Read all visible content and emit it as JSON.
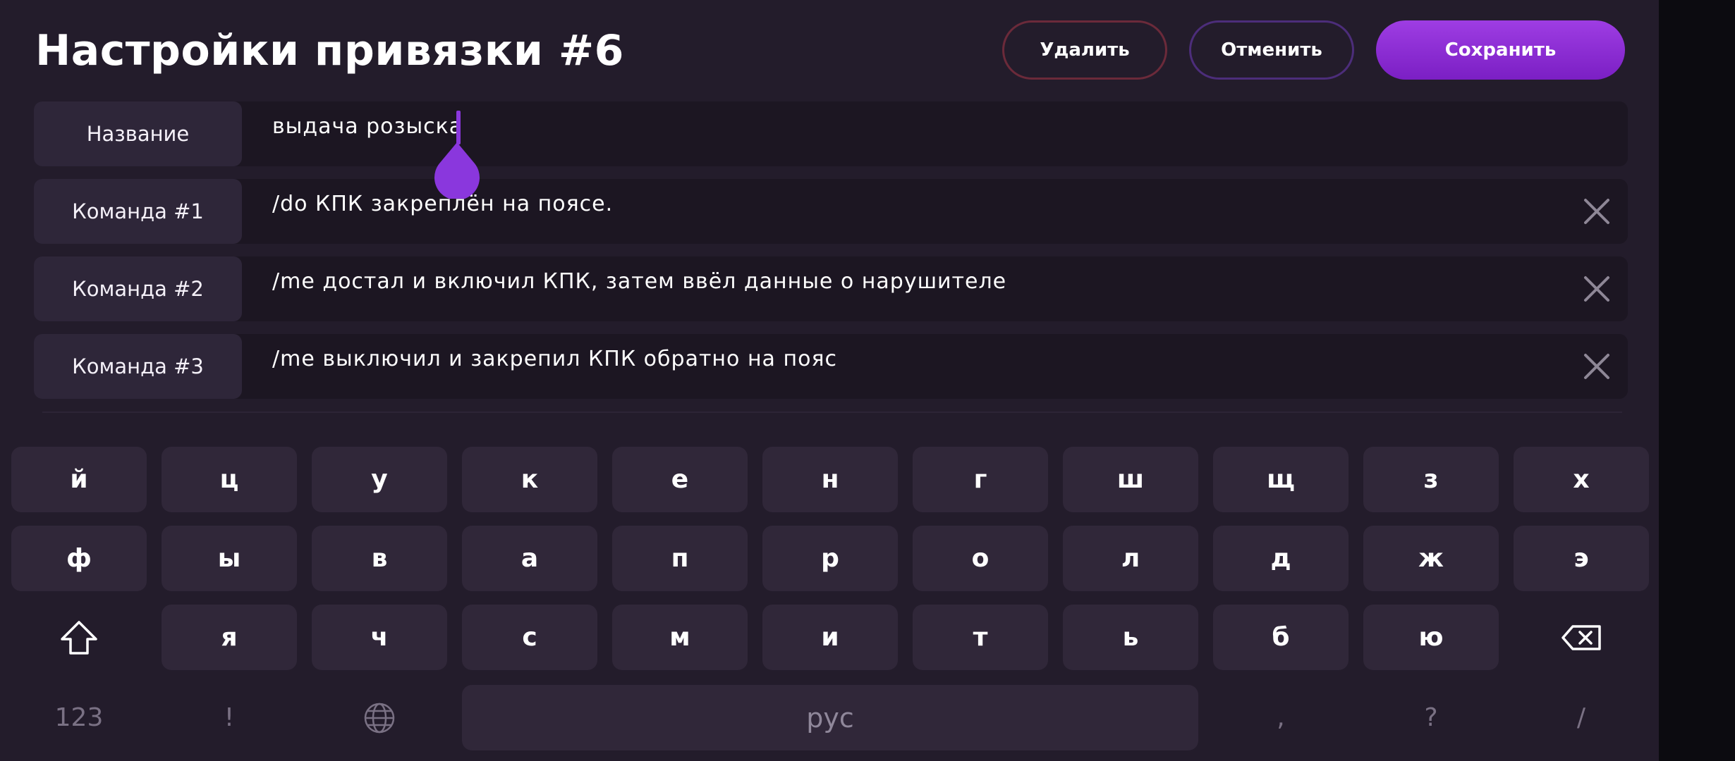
{
  "header": {
    "title": "Настройки привязки #6",
    "delete_label": "Удалить",
    "cancel_label": "Отменить",
    "save_label": "Сохранить"
  },
  "fields": [
    {
      "label": "Название",
      "value": "выдача розыска",
      "clearable": false
    },
    {
      "label": "Команда #1",
      "value": "/do КПК закреплён на поясе.",
      "clearable": true
    },
    {
      "label": "Команда #2",
      "value": "/me достал и включил КПК, затем ввёл данные о нарушителе",
      "clearable": true
    },
    {
      "label": "Команда #3",
      "value": "/me выключил и закрепил КПК обратно на пояс",
      "clearable": true
    }
  ],
  "keyboard": {
    "row1": [
      "й",
      "ц",
      "у",
      "к",
      "е",
      "н",
      "г",
      "ш",
      "щ",
      "з",
      "х"
    ],
    "row2": [
      "ф",
      "ы",
      "в",
      "а",
      "п",
      "р",
      "о",
      "л",
      "д",
      "ж",
      "э"
    ],
    "row3": [
      "я",
      "ч",
      "с",
      "м",
      "и",
      "т",
      "ь",
      "б",
      "ю"
    ],
    "row3_icons": {
      "left": "shift-icon",
      "right": "backspace-icon"
    },
    "bottom": {
      "numbers": "123",
      "exclamation": "!",
      "language_icon": "globe-icon",
      "space": "рус",
      "comma": ",",
      "question": "?",
      "slash": "/"
    }
  },
  "colors": {
    "background": "#231c2b",
    "accent": "#8a37dd",
    "delete_border": "#6b2a3a",
    "cancel_border": "#4c2d7a",
    "key": "#302739"
  }
}
